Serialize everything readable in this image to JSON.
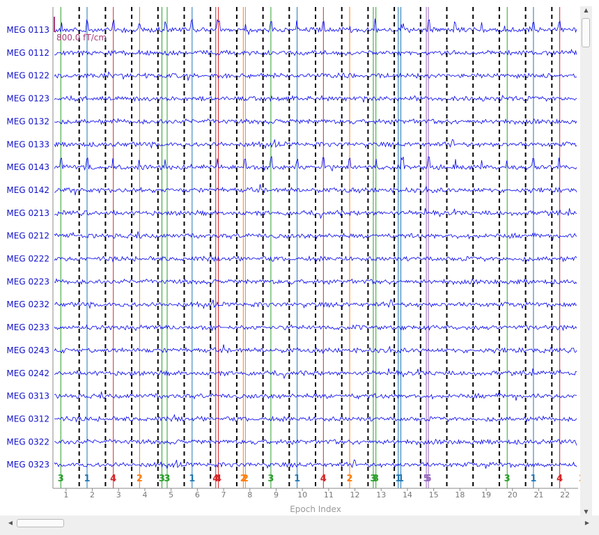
{
  "chart_data": {
    "type": "line",
    "title": "",
    "xlabel": "Epoch Index",
    "ylabel": "",
    "scale_label": "800.0 fT/cm",
    "channels": [
      "MEG 0113",
      "MEG 0112",
      "MEG 0122",
      "MEG 0123",
      "MEG 0132",
      "MEG 0133",
      "MEG 0143",
      "MEG 0142",
      "MEG 0213",
      "MEG 0212",
      "MEG 0222",
      "MEG 0223",
      "MEG 0232",
      "MEG 0233",
      "MEG 0243",
      "MEG 0242",
      "MEG 0313",
      "MEG 0312",
      "MEG 0322",
      "MEG 0323"
    ],
    "epoch_labels": [
      "1",
      "2",
      "3",
      "4",
      "5",
      "6",
      "7",
      "8",
      "9",
      "10",
      "11",
      "12",
      "13",
      "14",
      "15",
      "18",
      "19",
      "20",
      "21",
      "22"
    ],
    "events": [
      {
        "epoch": 1,
        "offset": 0.3,
        "id": 3
      },
      {
        "epoch": 2,
        "offset": 0.3,
        "id": 1
      },
      {
        "epoch": 3,
        "offset": 0.3,
        "id": 4
      },
      {
        "epoch": 4,
        "offset": 0.3,
        "id": 2
      },
      {
        "epoch": 5,
        "offset": 0.15,
        "id": 3
      },
      {
        "epoch": 5,
        "offset": 0.35,
        "id": 3
      },
      {
        "epoch": 6,
        "offset": 0.3,
        "id": 1
      },
      {
        "epoch": 7,
        "offset": 0.2,
        "id": 4
      },
      {
        "epoch": 7,
        "offset": 0.3,
        "id": 4
      },
      {
        "epoch": 8,
        "offset": 0.25,
        "id": 2
      },
      {
        "epoch": 8,
        "offset": 0.33,
        "id": 2
      },
      {
        "epoch": 9,
        "offset": 0.3,
        "id": 3
      },
      {
        "epoch": 10,
        "offset": 0.3,
        "id": 1
      },
      {
        "epoch": 11,
        "offset": 0.3,
        "id": 4
      },
      {
        "epoch": 12,
        "offset": 0.3,
        "id": 2
      },
      {
        "epoch": 13,
        "offset": 0.2,
        "id": 3
      },
      {
        "epoch": 13,
        "offset": 0.3,
        "id": 3
      },
      {
        "epoch": 14,
        "offset": 0.15,
        "id": 1
      },
      {
        "epoch": 14,
        "offset": 0.25,
        "id": 1
      },
      {
        "epoch": 15,
        "offset": 0.22,
        "id": 5
      },
      {
        "epoch": 15,
        "offset": 0.3,
        "id": 5
      },
      {
        "epoch": 18,
        "offset": 0.3,
        "id": 3
      },
      {
        "epoch": 19,
        "offset": 0.3,
        "id": 1
      },
      {
        "epoch": 20,
        "offset": 0.3,
        "id": 4
      },
      {
        "epoch": 21,
        "offset": 0.15,
        "id": 2
      },
      {
        "epoch": 21,
        "offset": 0.28,
        "id": 2
      },
      {
        "epoch": 22,
        "offset": 0.2,
        "id": 3
      },
      {
        "epoch": 22,
        "offset": 0.3,
        "id": 3
      }
    ],
    "event_colors": {
      "1": "#1f77b4",
      "2": "#ff7f0e",
      "3": "#2ca02c",
      "4": "#d62728",
      "5": "#9467bd"
    },
    "trace_color": "#0000ee",
    "label_color": "#1010cc",
    "scale_color": "#a83a7a",
    "boundary_color": "#000000",
    "axis_color": "#888888"
  }
}
